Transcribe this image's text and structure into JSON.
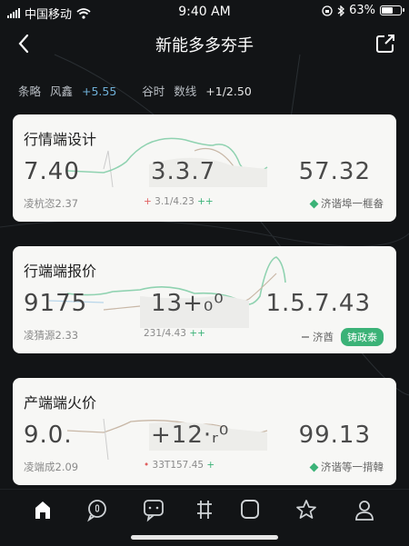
{
  "status_bar": {
    "carrier": "中国移动",
    "time": "9:40 AM",
    "battery_text": "63%",
    "battery_level": 0.63
  },
  "nav": {
    "title": "新能多多夯手",
    "back_icon": "chevron-left-icon",
    "share_icon": "share-icon"
  },
  "summary": {
    "label1": "条略",
    "label2": "风鑫",
    "change1": "+5.55",
    "label3": "谷时",
    "label4": "数线",
    "change2": "+1/2.50"
  },
  "cards": [
    {
      "name": "行情端设计",
      "value": "7.40",
      "mid_value": "3.3.7",
      "right_value": "57.32",
      "sub": "凌杭恣2.37",
      "mid_sub_a": "+",
      "mid_sub_b": "3.1/4.23",
      "mid_sub_c": "++",
      "right_sub": "济谐埠一榧畚",
      "right_tag": ""
    },
    {
      "name": "行端端报价",
      "value": "9175",
      "mid_value": "13+₀⁰",
      "right_value": "1.5.7.43",
      "sub": "凌猜源2.33",
      "mid_sub_a": "",
      "mid_sub_b": "231/4.43",
      "mid_sub_c": "++",
      "right_sub": "济酋",
      "right_tag": "铸政泰"
    },
    {
      "name": "产端端火价",
      "value": "9.0.",
      "mid_value": "+12·ᵣ⁰",
      "right_value": "99.13",
      "sub": "凌端成2.09",
      "mid_sub_a": "•",
      "mid_sub_b": "33T157.45",
      "mid_sub_c": "+",
      "right_sub": "济谐等一揹韓",
      "right_tag": ""
    }
  ],
  "tabs": [
    {
      "icon": "home-icon"
    },
    {
      "icon": "chat-bubble-icon"
    },
    {
      "icon": "message-icon"
    },
    {
      "icon": "grid-icon"
    },
    {
      "icon": "square-icon"
    },
    {
      "icon": "star-icon"
    },
    {
      "icon": "profile-icon"
    }
  ],
  "colors": {
    "accent_green": "#3bb277",
    "accent_red": "#e06060",
    "positive_blue": "#6fb0d8",
    "background": "#121416",
    "card": "#f7f7f5"
  }
}
